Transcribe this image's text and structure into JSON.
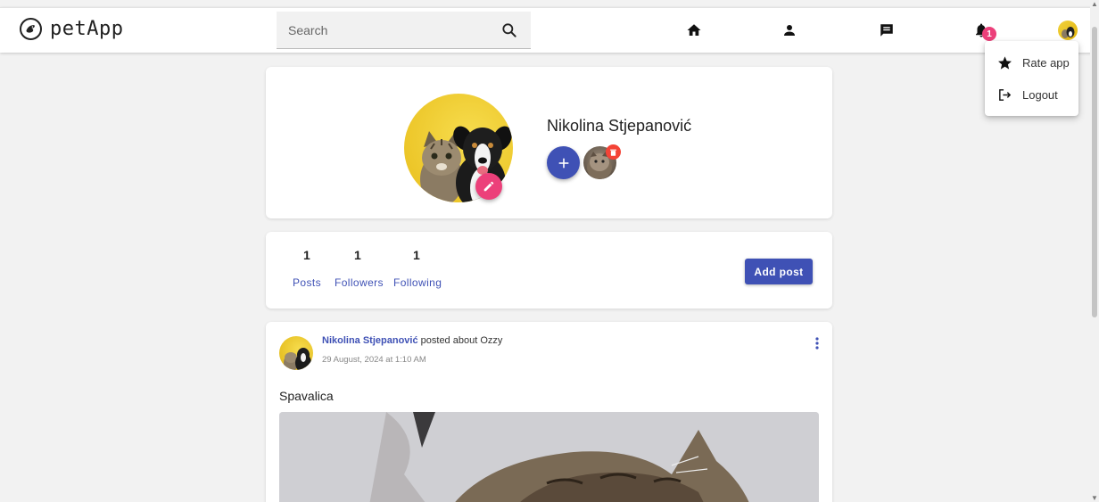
{
  "app": {
    "name": "petApp"
  },
  "search": {
    "placeholder": "Search"
  },
  "nav": {
    "icons": [
      "home-icon",
      "person-icon",
      "chat-icon",
      "bell-icon"
    ],
    "notifications_badge": "1"
  },
  "menu": {
    "items": [
      {
        "label": "Rate app",
        "icon": "star-icon"
      },
      {
        "label": "Logout",
        "icon": "logout-icon"
      }
    ]
  },
  "profile": {
    "name": "Nikolina Stjepanović"
  },
  "stats": {
    "posts": {
      "value": "1",
      "label": "Posts"
    },
    "followers": {
      "value": "1",
      "label": "Followers"
    },
    "following": {
      "value": "1",
      "label": "Following"
    },
    "add_post_label": "Add post"
  },
  "post": {
    "author": "Nikolina Stjepanović",
    "action": " posted about Ozzy",
    "date": "29 August, 2024 at 1:10 AM",
    "text": "Spavalica"
  },
  "colors": {
    "primary": "#3f51b5",
    "accent": "#ec407a",
    "danger": "#f44336",
    "background": "#f2f2f2"
  }
}
